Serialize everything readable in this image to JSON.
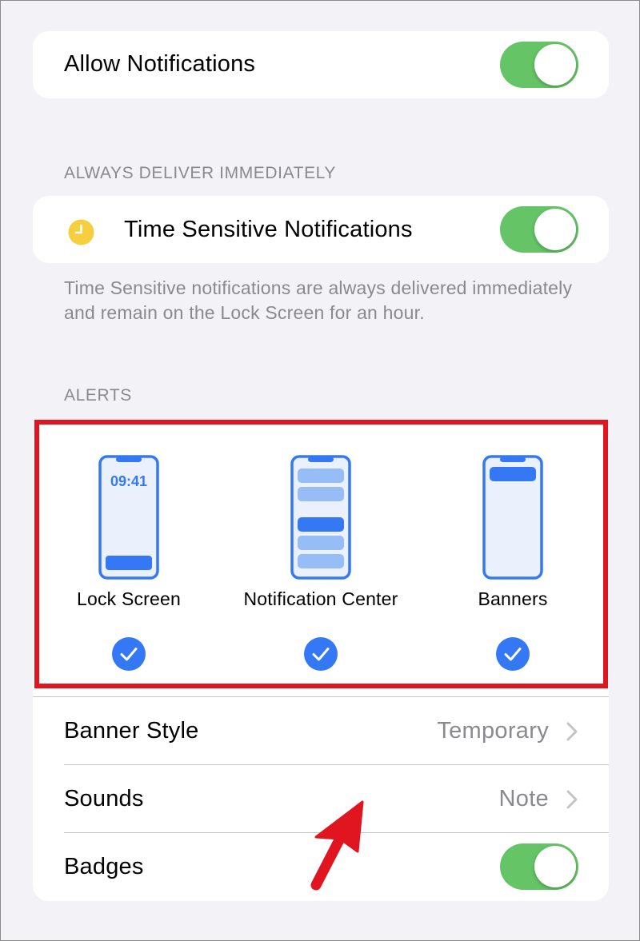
{
  "allow_notifications": {
    "label": "Allow Notifications",
    "enabled": true
  },
  "always_deliver": {
    "header": "ALWAYS DELIVER IMMEDIATELY",
    "time_sensitive": {
      "icon": "clock-icon",
      "label": "Time Sensitive Notifications",
      "enabled": true
    },
    "footer": "Time Sensitive notifications are always delivered immediately and remain on the Lock Screen for an hour."
  },
  "alerts": {
    "header": "ALERTS",
    "options": [
      {
        "label": "Lock Screen",
        "time": "09:41",
        "checked": true
      },
      {
        "label": "Notification Center",
        "checked": true
      },
      {
        "label": "Banners",
        "checked": true
      }
    ],
    "banner_style": {
      "label": "Banner Style",
      "value": "Temporary"
    },
    "sounds": {
      "label": "Sounds",
      "value": "Note"
    },
    "badges": {
      "label": "Badges",
      "enabled": true
    }
  },
  "colors": {
    "toggle_on": "#65c466",
    "accent_blue": "#3478f6",
    "highlight_red": "#e1151f",
    "secondary_text": "#8a8a8e"
  }
}
